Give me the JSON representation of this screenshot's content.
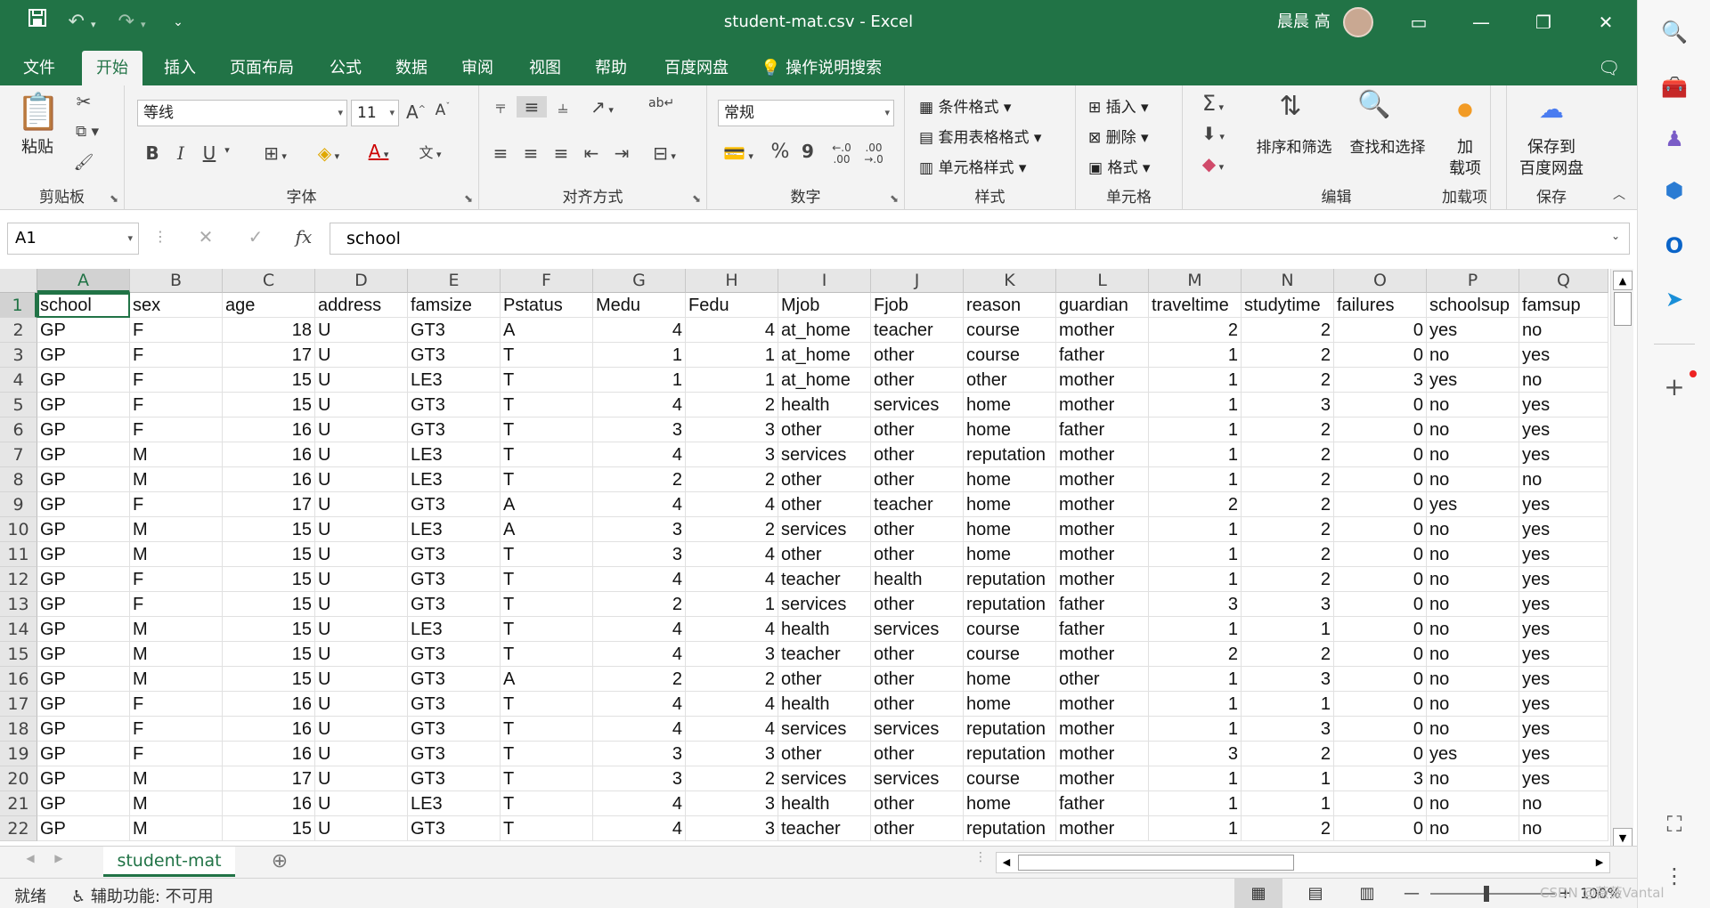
{
  "window": {
    "doc_title": "student-mat.csv  -  Excel",
    "user_name": "晨晨 高",
    "save_icon": "save-icon",
    "undo_icon": "undo-icon",
    "redo_icon": "redo-icon"
  },
  "menu": {
    "tabs": [
      "文件",
      "开始",
      "插入",
      "页面布局",
      "公式",
      "数据",
      "审阅",
      "视图",
      "帮助",
      "百度网盘"
    ],
    "active_tab": "开始",
    "search_label": "操作说明搜索"
  },
  "ribbon": {
    "clipboard": {
      "paste": "粘贴",
      "label": "剪贴板"
    },
    "font": {
      "name": "等线",
      "size": "11",
      "bold": "B",
      "italic": "I",
      "underline": "U",
      "label": "字体"
    },
    "alignment": {
      "label": "对齐方式"
    },
    "number": {
      "format": "常规",
      "percent": "%",
      "comma": "9",
      "label": "数字"
    },
    "styles": {
      "conditional": "条件格式",
      "table": "套用表格格式",
      "cell": "单元格样式",
      "label": "样式"
    },
    "cells": {
      "insert": "插入",
      "delete": "删除",
      "format": "格式",
      "label": "单元格"
    },
    "editing": {
      "sort": "排序和筛选",
      "find": "查找和选择",
      "label": "编辑"
    },
    "addins": {
      "button": "加\n载项",
      "label": "加载项"
    },
    "save": {
      "button": "保存到\n百度网盘",
      "label": "保存"
    }
  },
  "formula_bar": {
    "name_box": "A1",
    "content": "school",
    "fx": "fx"
  },
  "grid": {
    "columns": [
      "A",
      "B",
      "C",
      "D",
      "E",
      "F",
      "G",
      "H",
      "I",
      "J",
      "K",
      "L",
      "M",
      "N",
      "O",
      "P",
      "Q"
    ],
    "numeric_columns": [
      2,
      6,
      7,
      12,
      13,
      14
    ],
    "rows": [
      [
        "school",
        "sex",
        "age",
        "address",
        "famsize",
        "Pstatus",
        "Medu",
        "Fedu",
        "Mjob",
        "Fjob",
        "reason",
        "guardian",
        "traveltime",
        "studytime",
        "failures",
        "schoolsup",
        "famsup"
      ],
      [
        "GP",
        "F",
        "18",
        "U",
        "GT3",
        "A",
        "4",
        "4",
        "at_home",
        "teacher",
        "course",
        "mother",
        "2",
        "2",
        "0",
        "yes",
        "no"
      ],
      [
        "GP",
        "F",
        "17",
        "U",
        "GT3",
        "T",
        "1",
        "1",
        "at_home",
        "other",
        "course",
        "father",
        "1",
        "2",
        "0",
        "no",
        "yes"
      ],
      [
        "GP",
        "F",
        "15",
        "U",
        "LE3",
        "T",
        "1",
        "1",
        "at_home",
        "other",
        "other",
        "mother",
        "1",
        "2",
        "3",
        "yes",
        "no"
      ],
      [
        "GP",
        "F",
        "15",
        "U",
        "GT3",
        "T",
        "4",
        "2",
        "health",
        "services",
        "home",
        "mother",
        "1",
        "3",
        "0",
        "no",
        "yes"
      ],
      [
        "GP",
        "F",
        "16",
        "U",
        "GT3",
        "T",
        "3",
        "3",
        "other",
        "other",
        "home",
        "father",
        "1",
        "2",
        "0",
        "no",
        "yes"
      ],
      [
        "GP",
        "M",
        "16",
        "U",
        "LE3",
        "T",
        "4",
        "3",
        "services",
        "other",
        "reputation",
        "mother",
        "1",
        "2",
        "0",
        "no",
        "yes"
      ],
      [
        "GP",
        "M",
        "16",
        "U",
        "LE3",
        "T",
        "2",
        "2",
        "other",
        "other",
        "home",
        "mother",
        "1",
        "2",
        "0",
        "no",
        "no"
      ],
      [
        "GP",
        "F",
        "17",
        "U",
        "GT3",
        "A",
        "4",
        "4",
        "other",
        "teacher",
        "home",
        "mother",
        "2",
        "2",
        "0",
        "yes",
        "yes"
      ],
      [
        "GP",
        "M",
        "15",
        "U",
        "LE3",
        "A",
        "3",
        "2",
        "services",
        "other",
        "home",
        "mother",
        "1",
        "2",
        "0",
        "no",
        "yes"
      ],
      [
        "GP",
        "M",
        "15",
        "U",
        "GT3",
        "T",
        "3",
        "4",
        "other",
        "other",
        "home",
        "mother",
        "1",
        "2",
        "0",
        "no",
        "yes"
      ],
      [
        "GP",
        "F",
        "15",
        "U",
        "GT3",
        "T",
        "4",
        "4",
        "teacher",
        "health",
        "reputation",
        "mother",
        "1",
        "2",
        "0",
        "no",
        "yes"
      ],
      [
        "GP",
        "F",
        "15",
        "U",
        "GT3",
        "T",
        "2",
        "1",
        "services",
        "other",
        "reputation",
        "father",
        "3",
        "3",
        "0",
        "no",
        "yes"
      ],
      [
        "GP",
        "M",
        "15",
        "U",
        "LE3",
        "T",
        "4",
        "4",
        "health",
        "services",
        "course",
        "father",
        "1",
        "1",
        "0",
        "no",
        "yes"
      ],
      [
        "GP",
        "M",
        "15",
        "U",
        "GT3",
        "T",
        "4",
        "3",
        "teacher",
        "other",
        "course",
        "mother",
        "2",
        "2",
        "0",
        "no",
        "yes"
      ],
      [
        "GP",
        "M",
        "15",
        "U",
        "GT3",
        "A",
        "2",
        "2",
        "other",
        "other",
        "home",
        "other",
        "1",
        "3",
        "0",
        "no",
        "yes"
      ],
      [
        "GP",
        "F",
        "16",
        "U",
        "GT3",
        "T",
        "4",
        "4",
        "health",
        "other",
        "home",
        "mother",
        "1",
        "1",
        "0",
        "no",
        "yes"
      ],
      [
        "GP",
        "F",
        "16",
        "U",
        "GT3",
        "T",
        "4",
        "4",
        "services",
        "services",
        "reputation",
        "mother",
        "1",
        "3",
        "0",
        "no",
        "yes"
      ],
      [
        "GP",
        "F",
        "16",
        "U",
        "GT3",
        "T",
        "3",
        "3",
        "other",
        "other",
        "reputation",
        "mother",
        "3",
        "2",
        "0",
        "yes",
        "yes"
      ],
      [
        "GP",
        "M",
        "17",
        "U",
        "GT3",
        "T",
        "3",
        "2",
        "services",
        "services",
        "course",
        "mother",
        "1",
        "1",
        "3",
        "no",
        "yes"
      ],
      [
        "GP",
        "M",
        "16",
        "U",
        "LE3",
        "T",
        "4",
        "3",
        "health",
        "other",
        "home",
        "father",
        "1",
        "1",
        "0",
        "no",
        "no"
      ],
      [
        "GP",
        "M",
        "15",
        "U",
        "GT3",
        "T",
        "4",
        "3",
        "teacher",
        "other",
        "reputation",
        "mother",
        "1",
        "2",
        "0",
        "no",
        "no"
      ]
    ]
  },
  "sheets": {
    "active": "student-mat"
  },
  "status": {
    "ready": "就绪",
    "accessibility": "辅助功能: 不可用",
    "zoom": "100%",
    "watermark": "CSDN @薇薇Vantal"
  },
  "colors": {
    "accent": "#217346"
  }
}
